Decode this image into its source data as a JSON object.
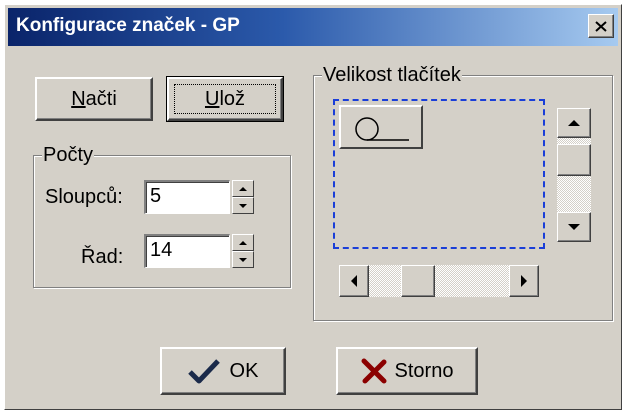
{
  "window": {
    "title": "Konfigurace značek - GP",
    "close_icon": "close-x-icon",
    "title_gradient": [
      "#0a246a",
      "#a6caf0"
    ]
  },
  "buttons": {
    "load_label": "Načti",
    "save_label": "Ulož",
    "ok_label": "OK",
    "cancel_label": "Storno",
    "ok_icon": "checkmark-icon",
    "cancel_icon": "x-mark-icon",
    "ok_icon_color": "#1a2a4a",
    "cancel_icon_color": "#8b0000"
  },
  "counts": {
    "group_label": "Počty",
    "columns_label": "Sloupců:",
    "columns_value": "5",
    "rows_label": "Řad:",
    "rows_value": "14"
  },
  "button_size": {
    "group_label": "Velikost tlačítek",
    "preview_border_color": "#1a3ed8",
    "sample_icon": "circle-on-line-icon"
  }
}
